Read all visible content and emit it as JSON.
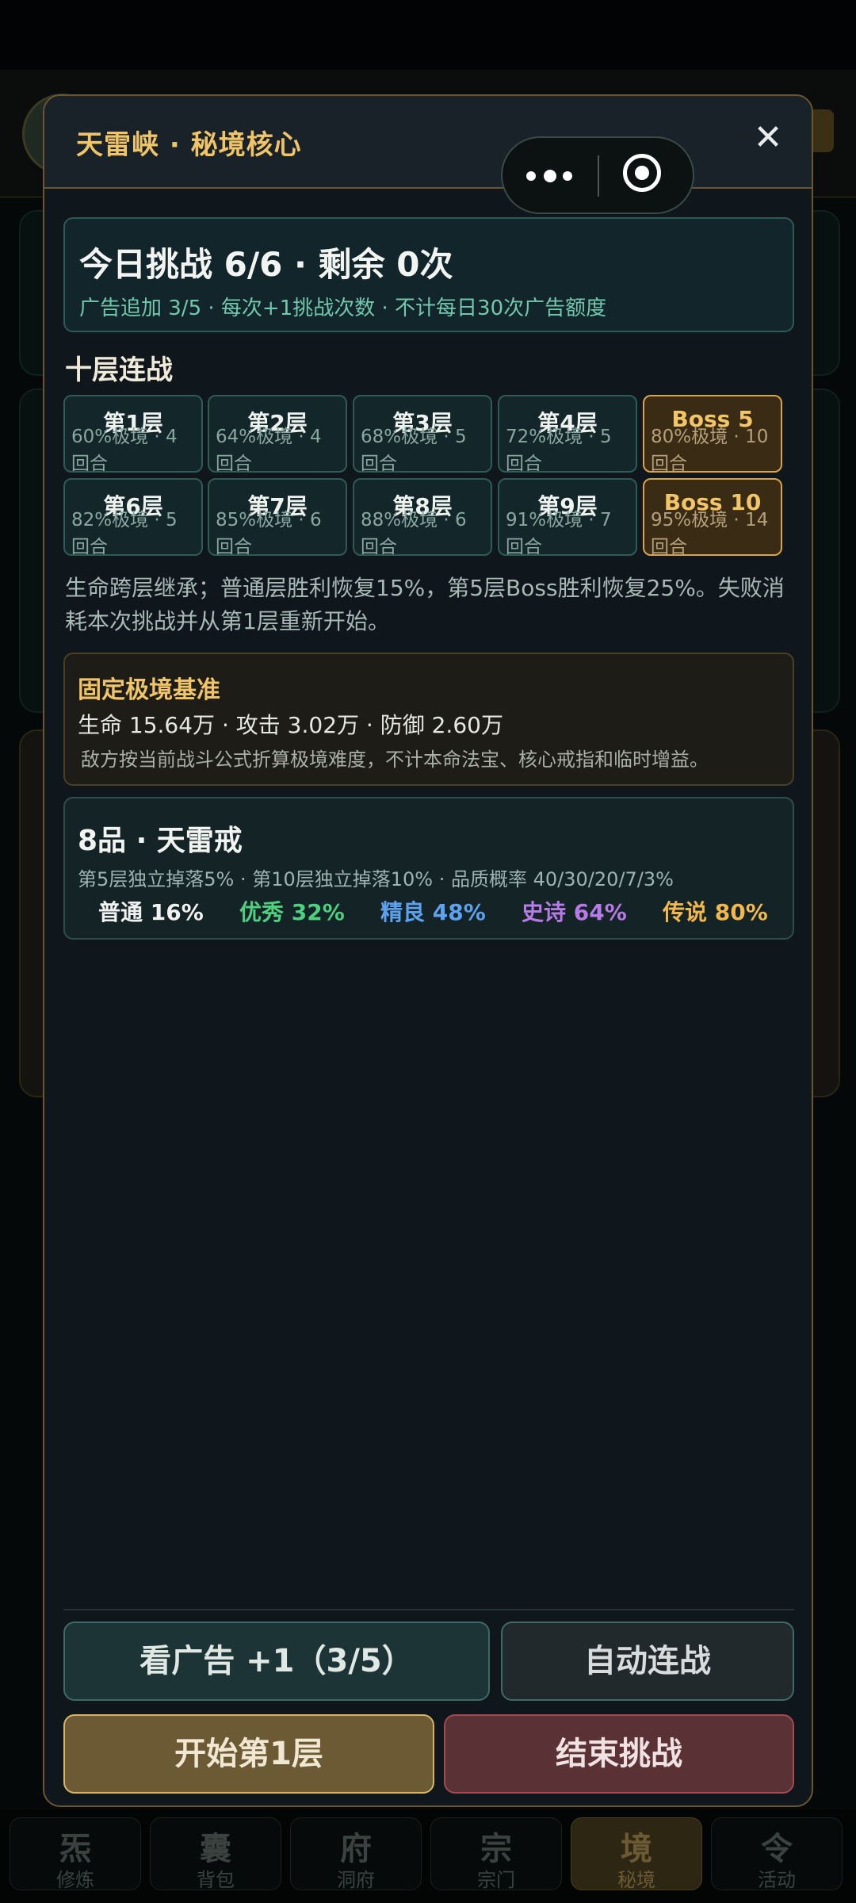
{
  "modal": {
    "title": "天雷峡 · 秘境核心",
    "close_icon": "close-icon",
    "challenge": {
      "title": "今日挑战 6/6 · 剩余 0次",
      "subtitle": "广告追加 3/5 · 每次+1挑战次数 · 不计每日30次广告额度"
    },
    "capsule": {
      "more_icon": "more-dots-icon",
      "close_icon": "target-circle-icon"
    },
    "section_title": "十层连战",
    "floors": [
      {
        "name": "第1层",
        "desc": "60%极境 · 4回合",
        "boss": false
      },
      {
        "name": "第2层",
        "desc": "64%极境 · 4回合",
        "boss": false
      },
      {
        "name": "第3层",
        "desc": "68%极境 · 5回合",
        "boss": false
      },
      {
        "name": "第4层",
        "desc": "72%极境 · 5回合",
        "boss": false
      },
      {
        "name": "Boss 5",
        "desc": "80%极境 · 10回合",
        "boss": true
      },
      {
        "name": "第6层",
        "desc": "82%极境 · 5回合",
        "boss": false
      },
      {
        "name": "第7层",
        "desc": "85%极境 · 6回合",
        "boss": false
      },
      {
        "name": "第8层",
        "desc": "88%极境 · 6回合",
        "boss": false
      },
      {
        "name": "第9层",
        "desc": "91%极境 · 7回合",
        "boss": false
      },
      {
        "name": "Boss 10",
        "desc": "95%极境 · 14回合",
        "boss": true
      }
    ],
    "rule_text": "生命跨层继承；普通层胜利恢复15%，第5层Boss胜利恢复25%。失败消耗本次挑战并从第1层重新开始。",
    "baseline": {
      "title": "固定极境基准",
      "stats": "生命 15.64万 · 攻击 3.02万 · 防御 2.60万",
      "note": "敌方按当前战斗公式折算极境难度，不计本命法宝、核心戒指和临时增益。"
    },
    "reward": {
      "title": "8品 · 天雷戒",
      "sub": "第5层独立掉落5% · 第10层独立掉落10% · 品质概率 40/30/20/7/3%",
      "qualities": [
        {
          "label": "普通 16%",
          "color": "#f2f2f2"
        },
        {
          "label": "优秀 32%",
          "color": "#4fd07e"
        },
        {
          "label": "精良 48%",
          "color": "#5ca2ee"
        },
        {
          "label": "史诗 64%",
          "color": "#b67be6"
        },
        {
          "label": "传说 80%",
          "color": "#f0b84e"
        }
      ]
    },
    "buttons": {
      "watch_ad": "看广告 +1（3/5）",
      "auto_battle": "自动连战",
      "start": "开始第1层",
      "end": "结束挑战"
    }
  },
  "bottom_nav": [
    {
      "glyph": "炁",
      "label": "修炼",
      "active": false
    },
    {
      "glyph": "囊",
      "label": "背包",
      "active": false
    },
    {
      "glyph": "府",
      "label": "洞府",
      "active": false
    },
    {
      "glyph": "宗",
      "label": "宗门",
      "active": false
    },
    {
      "glyph": "境",
      "label": "秘境",
      "active": true
    },
    {
      "glyph": "令",
      "label": "活动",
      "active": false
    }
  ]
}
